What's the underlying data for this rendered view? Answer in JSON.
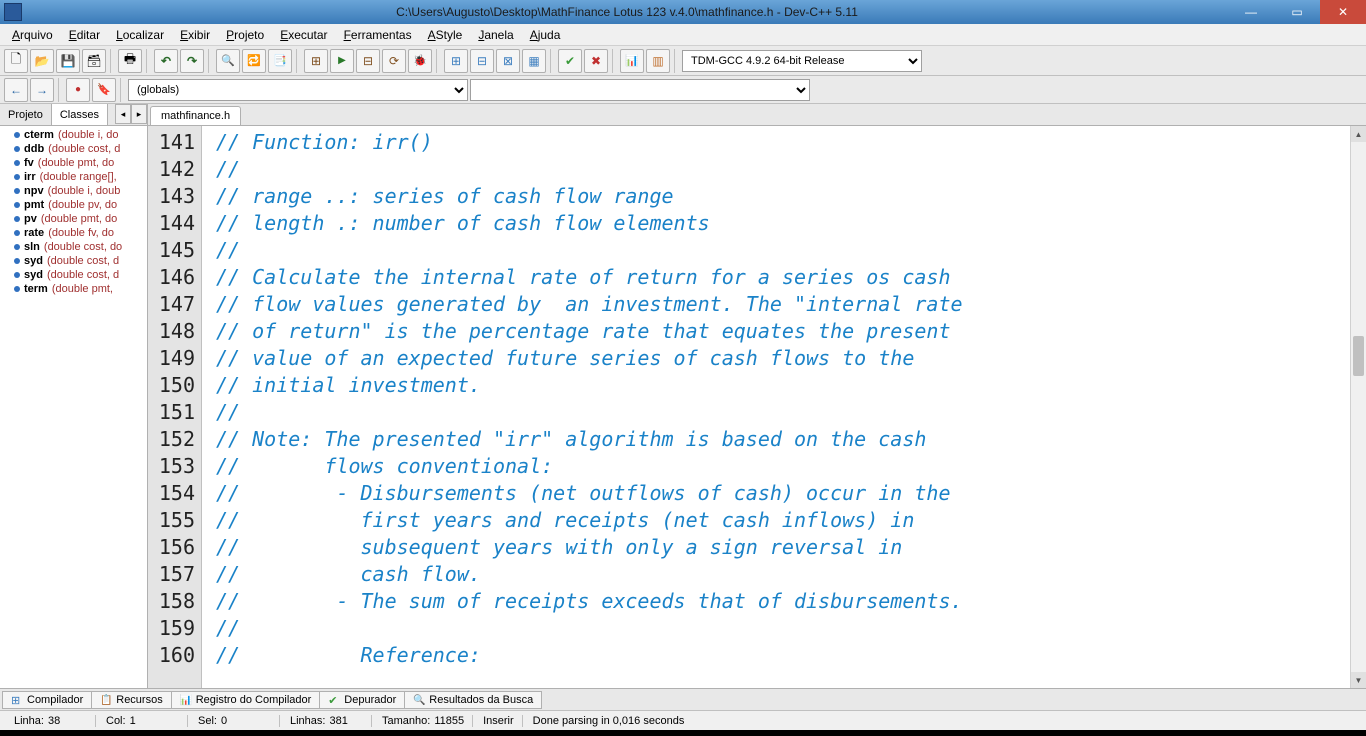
{
  "title": "C:\\Users\\Augusto\\Desktop\\MathFinance Lotus 123 v.4.0\\mathfinance.h - Dev-C++ 5.11",
  "menus": [
    "Arquivo",
    "Editar",
    "Localizar",
    "Exibir",
    "Projeto",
    "Executar",
    "Ferramentas",
    "AStyle",
    "Janela",
    "Ajuda"
  ],
  "compiler_select": "TDM-GCC 4.9.2 64-bit Release",
  "scope_select": "(globals)",
  "side_tabs": {
    "projeto": "Projeto",
    "classes": "Classes"
  },
  "tree": [
    {
      "name": "cterm",
      "sig": "(double i, do"
    },
    {
      "name": "ddb",
      "sig": "(double cost, d"
    },
    {
      "name": "fv",
      "sig": "(double pmt, do"
    },
    {
      "name": "irr",
      "sig": "(double range[],"
    },
    {
      "name": "npv",
      "sig": "(double i, doub"
    },
    {
      "name": "pmt",
      "sig": "(double pv, do"
    },
    {
      "name": "pv",
      "sig": "(double pmt, do"
    },
    {
      "name": "rate",
      "sig": "(double fv, do"
    },
    {
      "name": "sln",
      "sig": "(double cost, do"
    },
    {
      "name": "syd",
      "sig": "(double cost, d"
    },
    {
      "name": "syd",
      "sig": "(double cost, d"
    },
    {
      "name": "term",
      "sig": "(double pmt,"
    }
  ],
  "editor_tab": "mathfinance.h",
  "code_start_line": 141,
  "code_lines": [
    "// Function: irr()",
    "//",
    "// range ..: series of cash flow range",
    "// length .: number of cash flow elements",
    "//",
    "// Calculate the internal rate of return for a series os cash",
    "// flow values generated by  an investment. The \"internal rate",
    "// of return\" is the percentage rate that equates the present",
    "// value of an expected future series of cash flows to the",
    "// initial investment.",
    "//",
    "// Note: The presented \"irr\" algorithm is based on the cash",
    "//       flows conventional:",
    "//        - Disbursements (net outflows of cash) occur in the",
    "//          first years and receipts (net cash inflows) in",
    "//          subsequent years with only a sign reversal in",
    "//          cash flow.",
    "//        - The sum of receipts exceeds that of disbursements.",
    "//",
    "//          Reference:"
  ],
  "bottom_tabs": [
    "Compilador",
    "Recursos",
    "Registro do Compilador",
    "Depurador",
    "Resultados da Busca"
  ],
  "status": {
    "line_lbl": "Linha:",
    "line_val": "38",
    "col_lbl": "Col:",
    "col_val": "1",
    "sel_lbl": "Sel:",
    "sel_val": "0",
    "lines_lbl": "Linhas:",
    "lines_val": "381",
    "size_lbl": "Tamanho:",
    "size_val": "11855",
    "insert": "Inserir",
    "parse": "Done parsing in 0,016 seconds"
  }
}
